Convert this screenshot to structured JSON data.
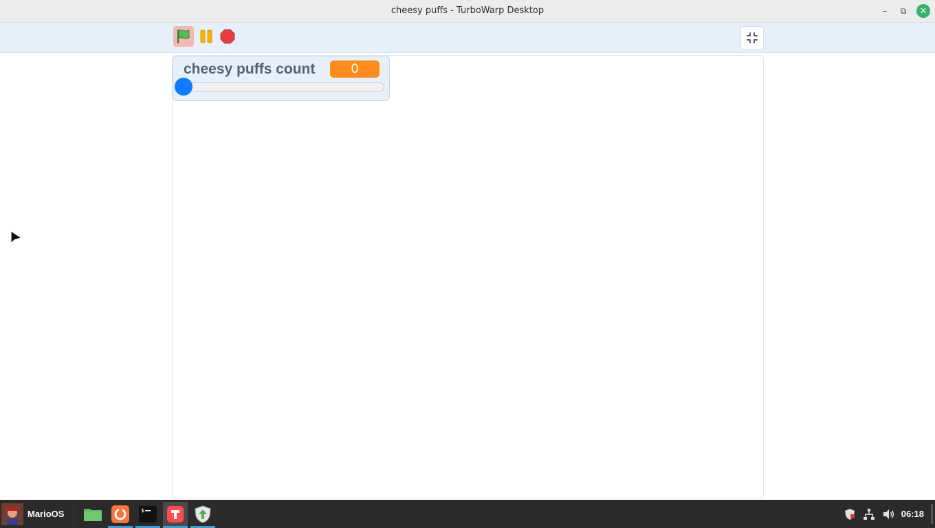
{
  "window": {
    "title": "cheesy puffs - TurboWarp Desktop",
    "controls": {
      "minimize": "–",
      "maximize": "⧉",
      "close": "✕"
    }
  },
  "toolbar": {
    "green_flag_icon": "green-flag-icon",
    "pause_icon": "pause-icon",
    "stop_icon": "stop-icon",
    "exit_fullscreen_icon": "exit-fullscreen-icon"
  },
  "stage": {
    "monitor": {
      "label": "cheesy puffs count",
      "value": "0",
      "slider_fraction": 0
    }
  },
  "taskbar": {
    "menu_label": "MarioOS",
    "apps": [
      {
        "name": "files",
        "icon": "folder-icon"
      },
      {
        "name": "firefox",
        "icon": "firefox-icon"
      },
      {
        "name": "terminal",
        "icon": "terminal-icon"
      },
      {
        "name": "turbowarp",
        "icon": "turbowarp-icon"
      },
      {
        "name": "update-manager",
        "icon": "shield-update-icon"
      }
    ],
    "tray": {
      "clock": "06:18",
      "icons": [
        "shield-icon",
        "network-icon",
        "volume-icon"
      ]
    }
  },
  "colors": {
    "accent_orange": "#ff8c1a",
    "slider_blue": "#0f7bff",
    "toolbar_bg": "#e6f0fa",
    "taskbar_bg": "#2b2b2b"
  }
}
